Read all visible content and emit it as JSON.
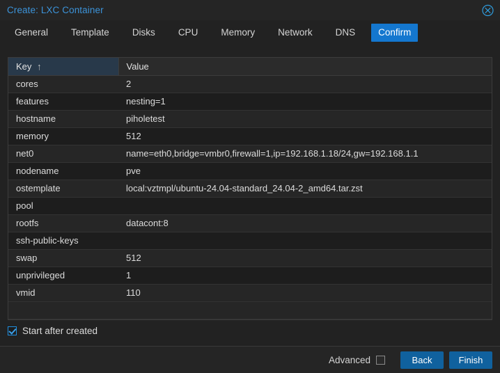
{
  "window": {
    "title": "Create: LXC Container",
    "close_icon": "close-circle-icon",
    "title_color": "#3c93d9"
  },
  "tabs": [
    {
      "label": "General",
      "active": false
    },
    {
      "label": "Template",
      "active": false
    },
    {
      "label": "Disks",
      "active": false
    },
    {
      "label": "CPU",
      "active": false
    },
    {
      "label": "Memory",
      "active": false
    },
    {
      "label": "Network",
      "active": false
    },
    {
      "label": "DNS",
      "active": false
    },
    {
      "label": "Confirm",
      "active": true
    }
  ],
  "table": {
    "columns": [
      {
        "label": "Key",
        "sorted": true,
        "sort_arrow": "↑"
      },
      {
        "label": "Value",
        "sorted": false,
        "sort_arrow": ""
      }
    ],
    "rows": [
      {
        "key": "cores",
        "value": "2"
      },
      {
        "key": "features",
        "value": "nesting=1"
      },
      {
        "key": "hostname",
        "value": "piholetest"
      },
      {
        "key": "memory",
        "value": "512"
      },
      {
        "key": "net0",
        "value": "name=eth0,bridge=vmbr0,firewall=1,ip=192.168.1.18/24,gw=192.168.1.1"
      },
      {
        "key": "nodename",
        "value": "pve"
      },
      {
        "key": "ostemplate",
        "value": "local:vztmpl/ubuntu-24.04-standard_24.04-2_amd64.tar.zst"
      },
      {
        "key": "pool",
        "value": ""
      },
      {
        "key": "rootfs",
        "value": "datacont:8"
      },
      {
        "key": "ssh-public-keys",
        "value": ""
      },
      {
        "key": "swap",
        "value": "512"
      },
      {
        "key": "unprivileged",
        "value": "1"
      },
      {
        "key": "vmid",
        "value": "110"
      }
    ]
  },
  "options": {
    "start_after_created": {
      "label": "Start after created",
      "checked": true
    }
  },
  "footer": {
    "advanced": {
      "label": "Advanced",
      "checked": false
    },
    "back_label": "Back",
    "finish_label": "Finish",
    "button_color": "#10619e"
  }
}
